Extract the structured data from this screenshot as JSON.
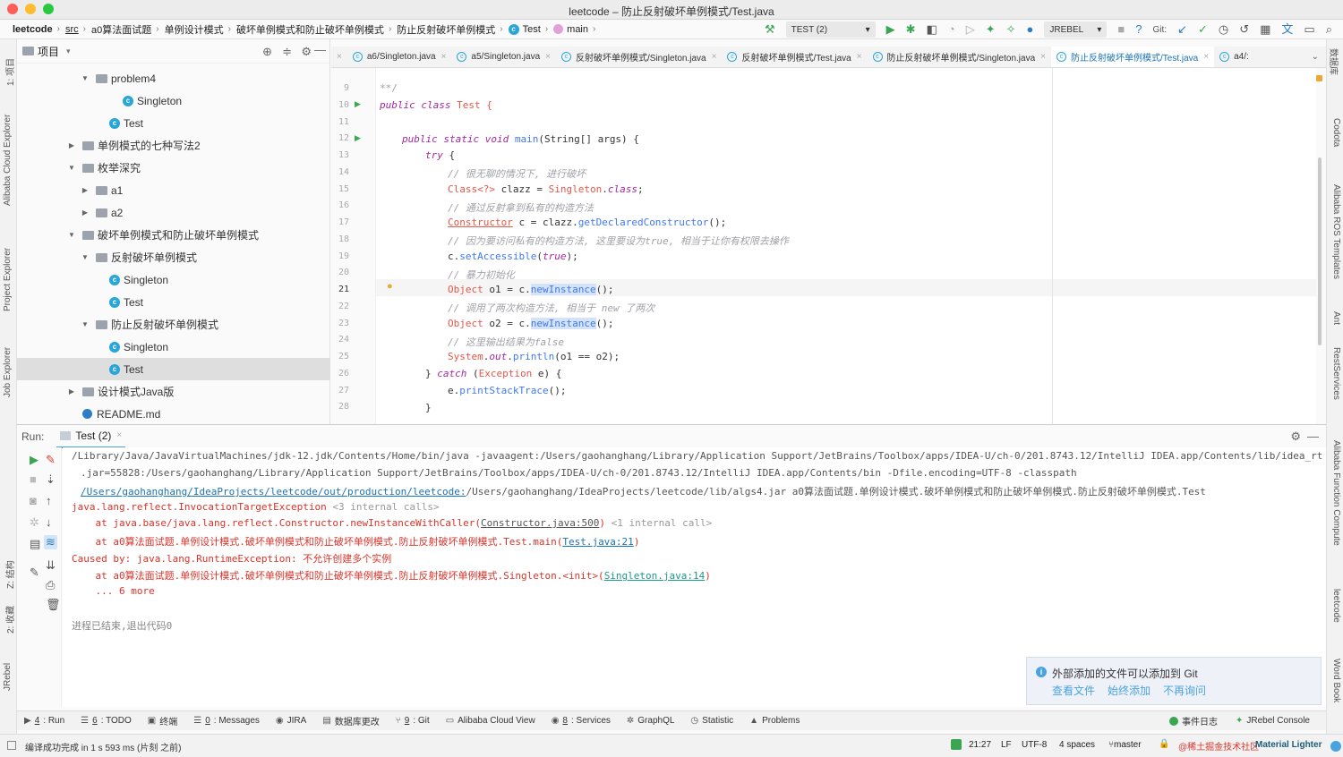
{
  "window": {
    "title": "leetcode – 防止反射破坏单例模式/Test.java"
  },
  "breadcrumbs": [
    "leetcode",
    "src",
    "a0算法面试题",
    "单例设计模式",
    "破坏单例模式和防止破坏单例模式",
    "防止反射破坏单例模式",
    "Test",
    "main"
  ],
  "toolbar": {
    "run_config": "TEST (2)",
    "jrebel": "JREBEL",
    "git_label": "Git:"
  },
  "left_strip": {
    "items": [
      "1: 项目",
      "Alibaba Cloud Explorer",
      "Project Explorer",
      "Job Explorer",
      "Z: 结构",
      "2: 收藏",
      "JRebel"
    ]
  },
  "right_strip": {
    "items": [
      "数据库",
      "Codota",
      "Alibaba ROS Templates",
      "Ant",
      "RestServices",
      "Alibaba Function Compute",
      "leetcode",
      "Word Book"
    ]
  },
  "project": {
    "title": "项目",
    "rows": [
      {
        "label": "problem4",
        "kind": "folder",
        "depth": 2,
        "arrow": "▼"
      },
      {
        "label": "Singleton",
        "kind": "class",
        "depth": 4,
        "arrow": ""
      },
      {
        "label": "Test",
        "kind": "class",
        "depth": 3,
        "arrow": ""
      },
      {
        "label": "单例模式的七种写法2",
        "kind": "folder",
        "depth": 1,
        "arrow": "▶"
      },
      {
        "label": "枚举深究",
        "kind": "folder",
        "depth": 1,
        "arrow": "▼"
      },
      {
        "label": "a1",
        "kind": "folder",
        "depth": 2,
        "arrow": "▶"
      },
      {
        "label": "a2",
        "kind": "folder",
        "depth": 2,
        "arrow": "▶"
      },
      {
        "label": "破坏单例模式和防止破坏单例模式",
        "kind": "folder",
        "depth": 1,
        "arrow": "▼"
      },
      {
        "label": "反射破坏单例模式",
        "kind": "folder",
        "depth": 2,
        "arrow": "▼"
      },
      {
        "label": "Singleton",
        "kind": "class",
        "depth": 3,
        "arrow": ""
      },
      {
        "label": "Test",
        "kind": "class",
        "depth": 3,
        "arrow": ""
      },
      {
        "label": "防止反射破坏单例模式",
        "kind": "folder",
        "depth": 2,
        "arrow": "▼"
      },
      {
        "label": "Singleton",
        "kind": "class",
        "depth": 3,
        "arrow": ""
      },
      {
        "label": "Test",
        "kind": "class",
        "depth": 3,
        "arrow": "",
        "selected": true
      },
      {
        "label": "设计模式Java版",
        "kind": "folder",
        "depth": 1,
        "arrow": "▶"
      },
      {
        "label": "README.md",
        "kind": "md",
        "depth": 1,
        "arrow": ""
      }
    ]
  },
  "tabs": [
    {
      "label": "a6/Singleton.java",
      "active": false
    },
    {
      "label": "a5/Singleton.java",
      "active": false
    },
    {
      "label": "反射破坏单例模式/Singleton.java",
      "active": false
    },
    {
      "label": "反射破坏单例模式/Test.java",
      "active": false
    },
    {
      "label": "防止反射破坏单例模式/Singleton.java",
      "active": false
    },
    {
      "label": "防止反射破坏单例模式/Test.java",
      "active": true
    },
    {
      "label": "a4/:",
      "active": false
    }
  ],
  "editor": {
    "line_numbers": [
      "9",
      "10",
      "11",
      "12",
      "13",
      "14",
      "15",
      "16",
      "17",
      "18",
      "19",
      "20",
      "21",
      "22",
      "23",
      "24",
      "25",
      "26",
      "27",
      "28"
    ],
    "lines": {
      "l9": "**/",
      "l10a": "public class",
      "l10b": " Test {",
      "l12a": "public static void",
      "l12b": "main",
      "l12c": "(String[] args) {",
      "l13a": "try",
      "l13b": " {",
      "l14": "// 很无聊的情况下, 进行破坏",
      "l15a": "Class<?>",
      "l15b": " clazz = ",
      "l15c": "Singleton",
      "l15d": ".",
      "l15e": "class",
      "l15f": ";",
      "l16": "// 通过反射拿到私有的构造方法",
      "l17a": "Constructor",
      "l17b": " c = clazz.",
      "l17c": "getDeclaredConstructor",
      "l17d": "();",
      "l18": "// 因为要访问私有的构造方法, 这里要设为true, 相当于让你有权限去操作",
      "l19a": "c.",
      "l19b": "setAccessible",
      "l19c": "(",
      "l19d": "true",
      "l19e": ");",
      "l20": "// 暴力初始化",
      "l21a": "Object",
      "l21b": " o1 = c.",
      "l21c": "newInstance",
      "l21d": "();",
      "l22": "// 调用了两次构造方法, 相当于 new 了两次",
      "l23a": "Object",
      "l23b": " o2 = c.",
      "l23c": "newInstance",
      "l23d": "();",
      "l24": "// 这里输出结果为false",
      "l25a": "System",
      "l25b": ".",
      "l25c": "out",
      "l25d": ".",
      "l25e": "println",
      "l25f": "(o1 == o2);",
      "l26a": "} ",
      "l26b": "catch",
      "l26c": " (",
      "l26d": "Exception",
      "l26e": " e) {",
      "l27a": "e.",
      "l27b": "printStackTrace",
      "l27c": "();",
      "l28": "}"
    }
  },
  "run": {
    "label": "Run:",
    "tab": "Test (2)",
    "console": {
      "c1": "/Library/Java/JavaVirtualMachines/jdk-12.jdk/Contents/Home/bin/java -javaagent:/Users/gaohanghang/Library/Application Support/JetBrains/Toolbox/apps/IDEA-U/ch-0/201.8743.12/IntelliJ IDEA.app/Contents/lib/idea_rt",
      "c2": ".jar=55828:/Users/gaohanghang/Library/Application Support/JetBrains/Toolbox/apps/IDEA-U/ch-0/201.8743.12/IntelliJ IDEA.app/Contents/bin -Dfile.encoding=UTF-8 -classpath",
      "c3a": "/Users/gaohanghang/IdeaProjects/leetcode/out/production/leetcode:",
      "c3b": "/Users/gaohanghang/IdeaProjects/leetcode/lib/algs4.jar a0算法面试题.单例设计模式.破坏单例模式和防止破坏单例模式.防止反射破坏单例模式.Test",
      "c4a": "java.lang.reflect.InvocationTargetException",
      "c4b": " <3 internal calls>",
      "c5a": "    at java.base/java.lang.reflect.Constructor.newInstanceWithCaller(",
      "c5b": "Constructor.java:500",
      "c5c": ")",
      "c5d": " <1 internal call>",
      "c6a": "    at a0算法面试题.单例设计模式.破坏单例模式和防止破坏单例模式.防止反射破坏单例模式.Test.main(",
      "c6b": "Test.java:21",
      "c6c": ")",
      "c7": "Caused by: java.lang.RuntimeException: 不允许创建多个实例",
      "c8a": "    at a0算法面试题.单例设计模式.破坏单例模式和防止破坏单例模式.防止反射破坏单例模式.Singleton.<init>(",
      "c8b": "Singleton.java:14",
      "c8c": ")",
      "c9": "    ... 6 more",
      "c10": "进程已结束,退出代码0"
    }
  },
  "notification": {
    "text": "外部添加的文件可以添加到 Git",
    "actions": [
      "查看文件",
      "始终添加",
      "不再询问"
    ]
  },
  "bottom_tools": [
    {
      "key": "4",
      "label": ": Run"
    },
    {
      "key": "6",
      "label": ": TODO"
    },
    {
      "key": "",
      "label": "终端"
    },
    {
      "key": "0",
      "label": ": Messages"
    },
    {
      "key": "",
      "label": "JIRA"
    },
    {
      "key": "",
      "label": "数据库更改"
    },
    {
      "key": "9",
      "label": ": Git"
    },
    {
      "key": "",
      "label": "Alibaba Cloud View"
    },
    {
      "key": "8",
      "label": ": Services"
    },
    {
      "key": "",
      "label": "GraphQL"
    },
    {
      "key": "",
      "label": "Statistic"
    },
    {
      "key": "",
      "label": "Problems"
    }
  ],
  "bottom_right": {
    "event_log": "事件日志",
    "jrebel_console": "JRebel Console"
  },
  "status": {
    "message": "编译成功完成 in 1 s 593 ms (片刻 之前)",
    "position": "21:27",
    "line_sep": "LF",
    "encoding": "UTF-8",
    "indent": "4 spaces",
    "branch": "master",
    "theme": "Material Lighter",
    "watermark": "@稀土掘金技术社区"
  },
  "colors": {
    "accent": "#4aa3df",
    "error": "#d9342b",
    "link": "#1a73b5",
    "run_green": "#3aa651"
  }
}
